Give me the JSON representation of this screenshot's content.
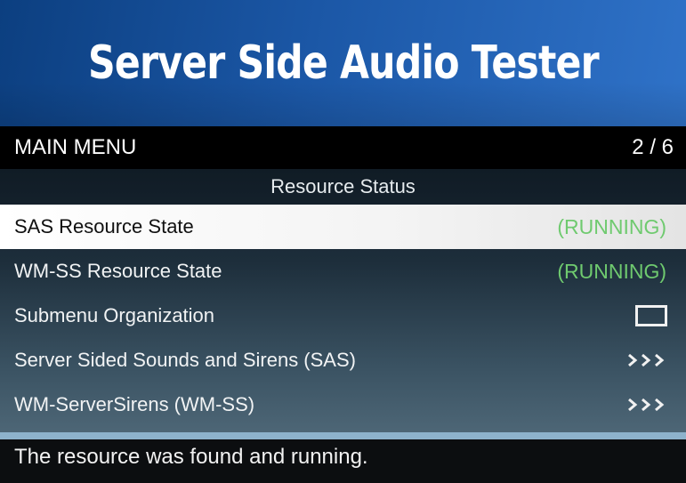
{
  "banner": {
    "title": "Server Side Audio Tester"
  },
  "header": {
    "menu_title": "MAIN MENU",
    "page_counter": "2 / 6"
  },
  "section": {
    "title": "Resource Status"
  },
  "items": [
    {
      "label": "SAS Resource State",
      "value": "(RUNNING)",
      "type": "status",
      "selected": true
    },
    {
      "label": "WM-SS Resource State",
      "value": "(RUNNING)",
      "type": "status",
      "selected": false
    },
    {
      "label": "Submenu Organization",
      "type": "checkbox",
      "checked": false,
      "icon": "checkbox-icon"
    },
    {
      "label": "Server Sided Sounds and Sirens (SAS)",
      "type": "submenu",
      "icon": "chevron-right-triple-icon"
    },
    {
      "label": "WM-ServerSirens (WM-SS)",
      "type": "submenu",
      "icon": "chevron-right-triple-icon"
    }
  ],
  "description": {
    "text": "The resource was found and running."
  },
  "colors": {
    "banner_blue": "#1b57a6",
    "running_green": "#6fca6f",
    "selected_bg": "#ffffff",
    "scrollbar": "#8db2cc"
  }
}
